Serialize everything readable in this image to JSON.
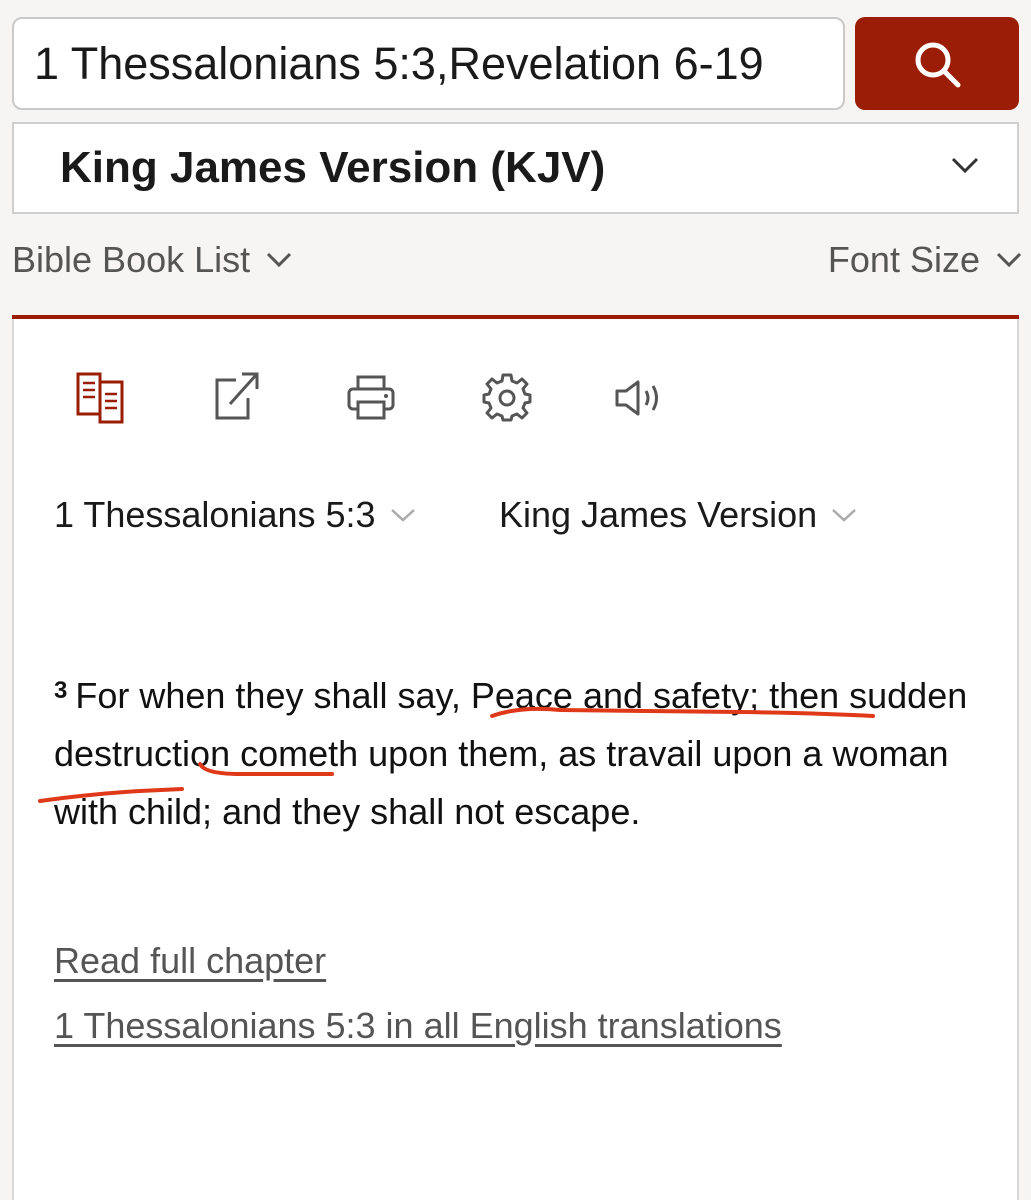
{
  "search": {
    "value": "1 Thessalonians 5:3,Revelation 6-19"
  },
  "icons": {
    "search": "search-icon",
    "chevron": "chevron-down-icon",
    "toolbar": [
      "parallel-view-icon",
      "external-link-icon",
      "print-icon",
      "settings-icon",
      "audio-icon"
    ]
  },
  "version_select": {
    "label": "King James Version (KJV)"
  },
  "subnav": {
    "book_list": "Bible Book List",
    "font_size": "Font Size"
  },
  "passage": {
    "reference": "1 Thessalonians 5:3",
    "version": "King James Version",
    "verse_number": "3",
    "verse_text": {
      "part1": "For when they shall say, ",
      "part2": "Peace and safety; then sudden destruction cometh upon them, as travail upon a woman with child; and they shall not escape."
    }
  },
  "links": {
    "read_full_chapter": "Read full chapter",
    "all_translations": "1 Thessalonians 5:3 in all English translations"
  },
  "colors": {
    "accent": "#9b1d05",
    "annotation": "#e0391a",
    "background": "#f6f5f3"
  }
}
